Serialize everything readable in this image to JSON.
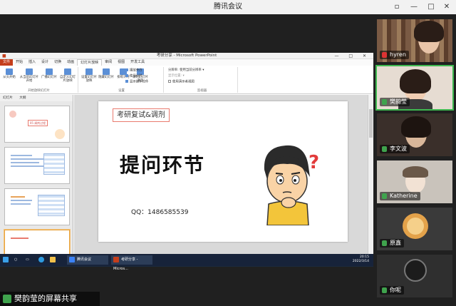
{
  "meeting": {
    "title": "腾讯会议",
    "share_banner": "樊韵莹的屏幕共享"
  },
  "ppt": {
    "window_title": "考研分享 - Microsoft PowerPoint",
    "tabs": [
      "文件",
      "开始",
      "插入",
      "设计",
      "切换",
      "动画",
      "幻灯片放映",
      "审阅",
      "视图",
      "开发工具"
    ],
    "active_tab": "幻灯片放映",
    "ribbon_groups": [
      {
        "label": "开始放映幻灯片",
        "buttons": [
          "从头开始",
          "从当前幻灯片开始",
          "广播幻灯片",
          "自定义幻灯片放映"
        ]
      },
      {
        "label": "设置",
        "buttons": [
          "设置幻灯片放映",
          "隐藏幻灯片",
          "排练计时",
          "录制幻灯片演示"
        ]
      },
      {
        "label": "监视器",
        "checks": [
          "播放旁白",
          "使用计时",
          "显示媒体控件"
        ]
      }
    ],
    "monitor": {
      "resolution_label": "分辨率:",
      "resolution_value": "使用当前分辨率",
      "show_on": "显示位置:",
      "presenter_view": "使用演示者视图"
    },
    "thumb_tabs": [
      "幻灯片",
      "大纲"
    ],
    "thumb_badge": "05 调剂过程",
    "slide": {
      "tag": "考研复试&调剂",
      "heading": "提问环节",
      "qq": "QQ：1486585539"
    },
    "status": {
      "left": "幻灯片 第 18 张，共 19 张   \"第一PPT, www.1ppt.com\"   中文(中国)",
      "zoom": "71%"
    }
  },
  "taskbar": {
    "items": [
      "腾讯会议",
      "考研分享 - Micros..."
    ],
    "time": "20:15",
    "date": "2022/3/14"
  },
  "participants": [
    {
      "name": "hyren",
      "mic": "off"
    },
    {
      "name": "樊韵莹",
      "mic": "on"
    },
    {
      "name": "李文波",
      "mic": "on"
    },
    {
      "name": "Katherine",
      "mic": "on"
    },
    {
      "name": "原鑫",
      "mic": "on"
    },
    {
      "name": "你呢",
      "mic": "on"
    }
  ],
  "colors": {
    "ppt_accent": "#c43e1c",
    "mic_on": "#3fa34d",
    "mic_off": "#dd3333",
    "taskbar": "#17233a"
  }
}
